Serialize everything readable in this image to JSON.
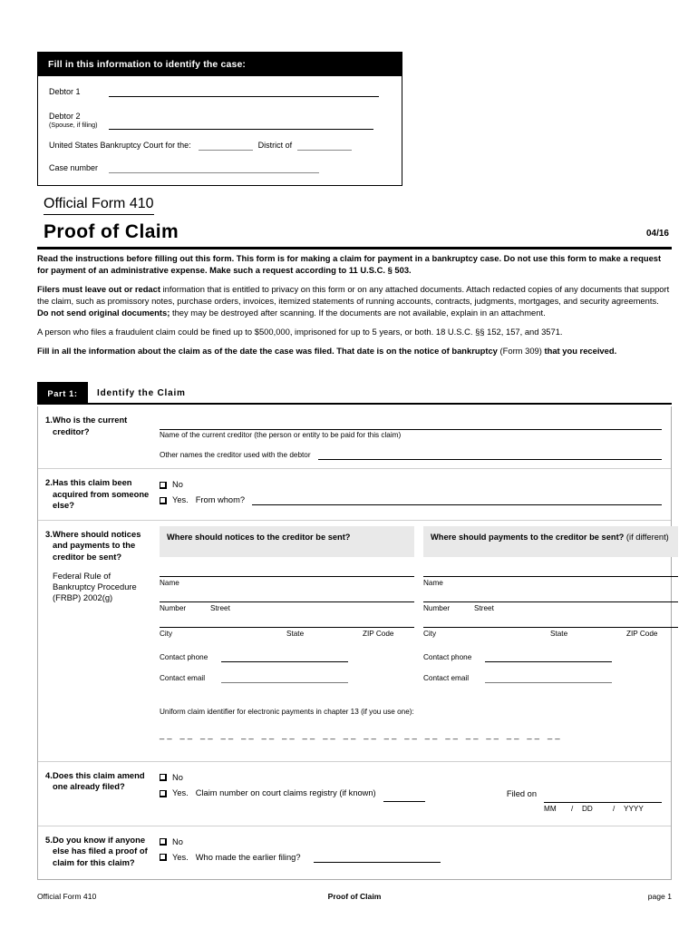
{
  "case_box": {
    "header": "Fill in this information to identify the case:",
    "debtor1_label": "Debtor 1",
    "debtor2_label": "Debtor 2",
    "debtor2_sub": "(Spouse, if filing)",
    "court_label": "United States Bankruptcy Court for the:",
    "district_label": "District of",
    "case_number_label": "Case number"
  },
  "title": {
    "form_number": "Official Form 410",
    "form_name": "Proof of Claim",
    "revision": "04/16"
  },
  "intro": {
    "p1_bold": "Read the instructions before filling out this form. This form is for making a claim for payment in a bankruptcy case. Do not use this form to make a request for payment of an administrative expense. Make such a request according to 11 U.S.C. § 503.",
    "p2_lead": "Filers must leave out or redact",
    "p2_mid": " information that is entitled to privacy on this form or on any attached documents. Attach redacted copies of any documents that support the claim, such as promissory notes, purchase orders, invoices, itemized statements of running accounts, contracts, judgments, mortgages, and security agreements. ",
    "p2_bold2": "Do not send original documents;",
    "p2_tail": " they may be destroyed after scanning. If the documents are not available, explain in an attachment.",
    "p3": "A person who files a fraudulent claim could be fined up to $500,000, imprisoned for up to 5 years, or both. 18 U.S.C. §§ 152, 157, and 3571.",
    "p4_bold": "Fill in all the information about the claim as of the date the case was filed. That date is on the notice of bankruptcy ",
    "p4_reg": "(Form 309)",
    "p4_bold2": " that you received."
  },
  "part1": {
    "tag": "Part 1:",
    "name": "Identify the Claim"
  },
  "q1": {
    "num": "1.",
    "label": "Who is the current creditor?",
    "cap1": "Name of the current creditor (the person or entity to be paid for this claim)",
    "cap2": "Other names the creditor used with the debtor"
  },
  "q2": {
    "num": "2.",
    "label": "Has this claim been acquired from someone else?",
    "opt_no": "No",
    "opt_yes": "Yes.",
    "from_whom": "From whom?"
  },
  "q3": {
    "num": "3.",
    "label": "Where should notices and payments to the creditor be sent?",
    "sub": "Federal Rule of Bankruptcy Procedure (FRBP) 2002(g)",
    "head_notices": "Where should notices to the creditor be sent?",
    "head_payments": "Where should payments to the creditor be sent?",
    "head_payments_reg": " (if different)",
    "cap_name": "Name",
    "cap_number": "Number",
    "cap_street": "Street",
    "cap_city": "City",
    "cap_state": "State",
    "cap_zip": "ZIP Code",
    "cap_phone": "Contact phone",
    "cap_email": "Contact email",
    "uniform_label": "Uniform claim identifier for electronic payments in chapter 13 (if you use one):",
    "uniform_dashes": "__ __ __ __ __ __ __ __ __ __ __ __ __ __ __ __ __ __ __ __"
  },
  "q4": {
    "num": "4.",
    "label": "Does this claim amend one already filed?",
    "opt_no": "No",
    "opt_yes": "Yes.",
    "claim_number": "Claim number on court claims registry (if known)",
    "filed_on": "Filed on",
    "date_mm": "MM",
    "date_sep1": "/",
    "date_dd": "DD",
    "date_sep2": "/",
    "date_yyyy": "YYYY"
  },
  "q5": {
    "num": "5.",
    "label": "Do you know if anyone else has filed a proof of claim for this claim?",
    "opt_no": "No",
    "opt_yes": "Yes.",
    "who_filed": "Who made the earlier filing?"
  },
  "footer": {
    "left": "Official Form 410",
    "center": "Proof of Claim",
    "right": "page 1"
  }
}
